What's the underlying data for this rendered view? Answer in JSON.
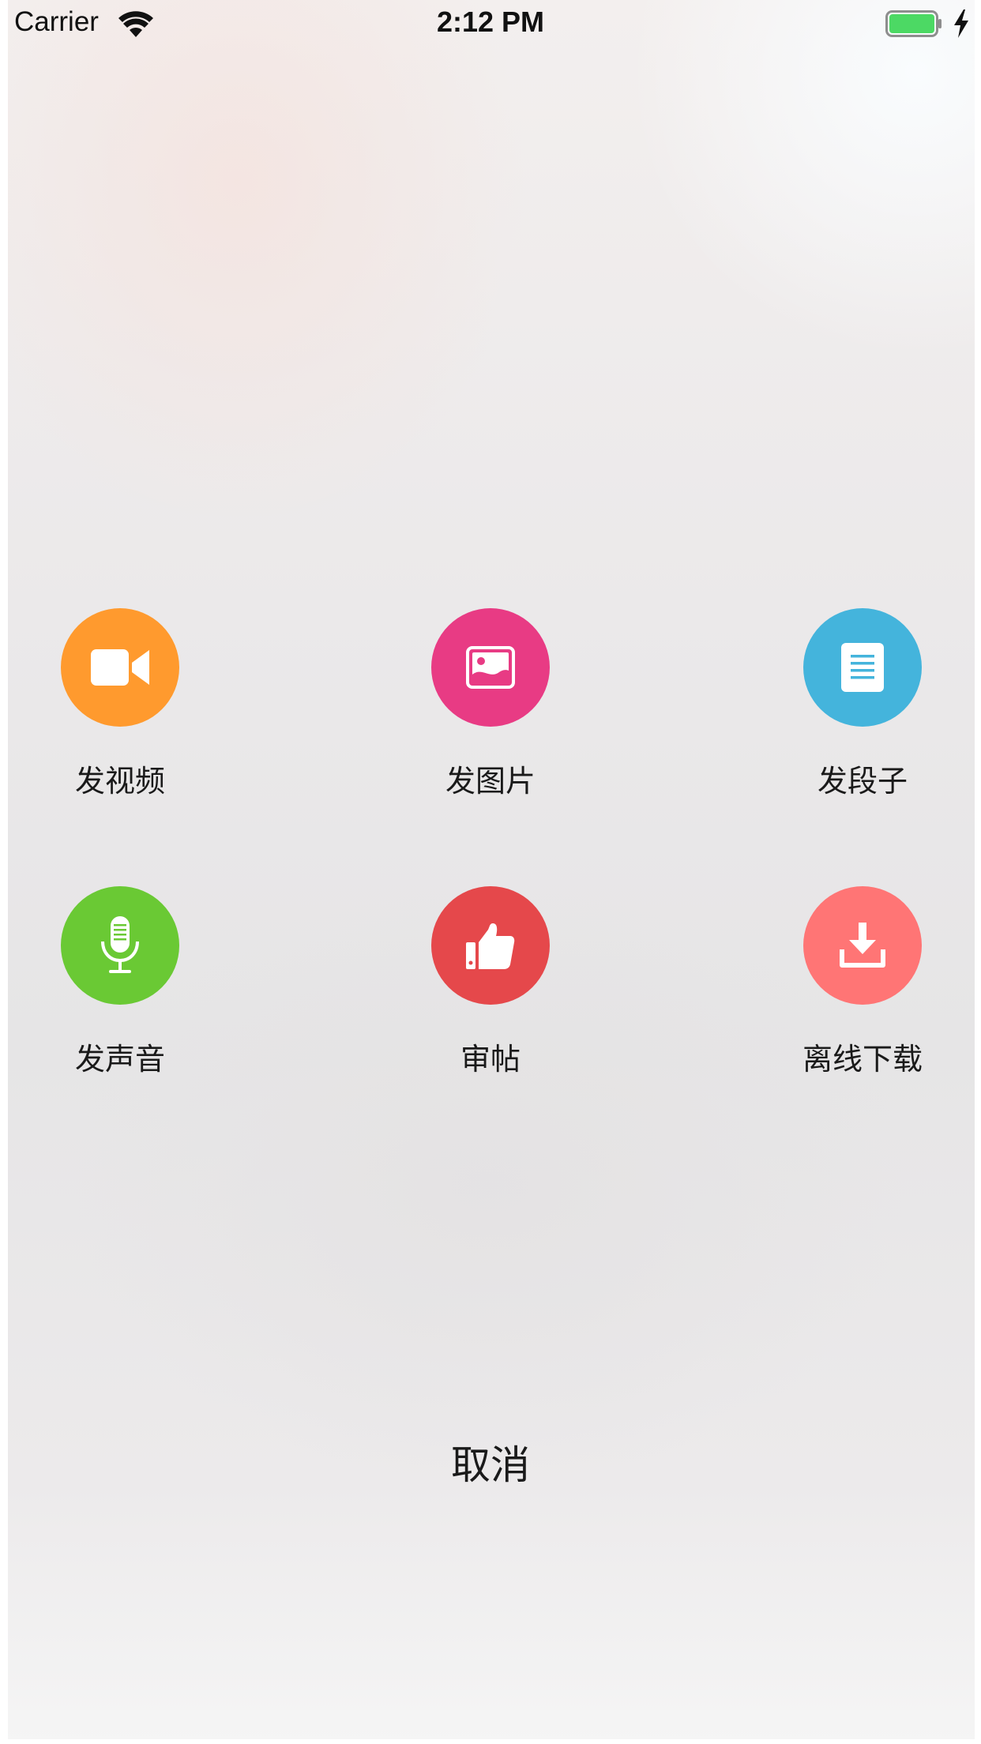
{
  "status_bar": {
    "carrier": "Carrier",
    "time": "2:12 PM",
    "wifi_icon": "wifi-icon",
    "battery_icon": "battery-icon",
    "charging_icon": "charging-bolt-icon",
    "battery_color": "#4cd964"
  },
  "actions": [
    {
      "label": "发视频",
      "icon": "video-camera-icon",
      "color": "#ff9a2e"
    },
    {
      "label": "发图片",
      "icon": "picture-icon",
      "color": "#e83b84"
    },
    {
      "label": "发段子",
      "icon": "document-icon",
      "color": "#44b4dc"
    },
    {
      "label": "发声音",
      "icon": "microphone-icon",
      "color": "#6ac934"
    },
    {
      "label": "审帖",
      "icon": "thumbs-up-icon",
      "color": "#e5484b"
    },
    {
      "label": "离线下载",
      "icon": "download-icon",
      "color": "#ff7575"
    }
  ],
  "cancel_label": "取消"
}
